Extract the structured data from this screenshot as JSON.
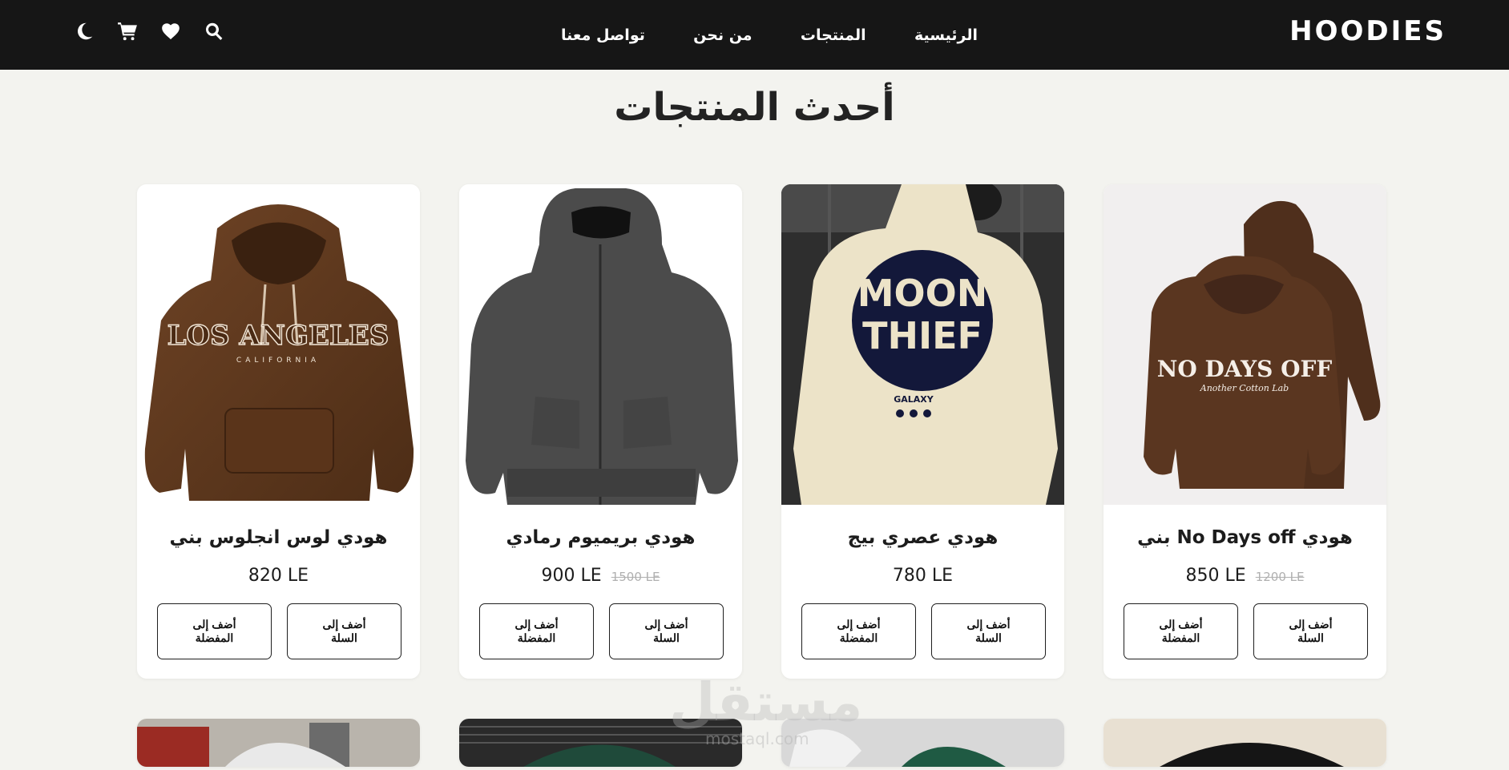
{
  "header": {
    "brand": "HOODIES",
    "nav": [
      {
        "label": "الرئيسية"
      },
      {
        "label": "المنتجات"
      },
      {
        "label": "من نحن"
      },
      {
        "label": "تواصل معنا"
      }
    ],
    "icons": [
      "search-icon",
      "heart-icon",
      "cart-icon",
      "moon-icon"
    ]
  },
  "main": {
    "section_title": "أحدث المنتجات"
  },
  "products": [
    {
      "name": "هودي No Days off بني",
      "price": "850 LE",
      "old_price": "1200 LE",
      "add_to_cart": "أضف إلى السلة",
      "add_to_favorites": "أضف إلى المفضلة"
    },
    {
      "name": "هودي عصري بيج",
      "price": "780 LE",
      "old_price": "",
      "add_to_cart": "أضف إلى السلة",
      "add_to_favorites": "أضف إلى المفضلة"
    },
    {
      "name": "هودي بريميوم رمادي",
      "price": "900 LE",
      "old_price": "1500 LE",
      "add_to_cart": "أضف إلى السلة",
      "add_to_favorites": "أضف إلى المفضلة"
    },
    {
      "name": "هودي لوس انجلوس بني",
      "price": "820 LE",
      "old_price": "",
      "add_to_cart": "أضف إلى السلة",
      "add_to_favorites": "أضف إلى المفضلة"
    }
  ],
  "product_images": {
    "p1": {
      "print_title": "NO DAYS OFF",
      "print_subtitle": "Another Cotton Lab"
    },
    "p2": {
      "print_line1": "MOON",
      "print_line2": "THIEF",
      "print_sub": "GALAXY"
    },
    "p4": {
      "print_title": "LOS ANGELES",
      "print_sub": "CALIFORNIA"
    }
  },
  "watermark": {
    "main": "مستقل",
    "sub": "mostaql.com"
  },
  "colors": {
    "header_bg": "#161616",
    "page_bg": "#f3f3ef",
    "card_bg": "#ffffff",
    "accent_text": "#1c1c1c"
  }
}
